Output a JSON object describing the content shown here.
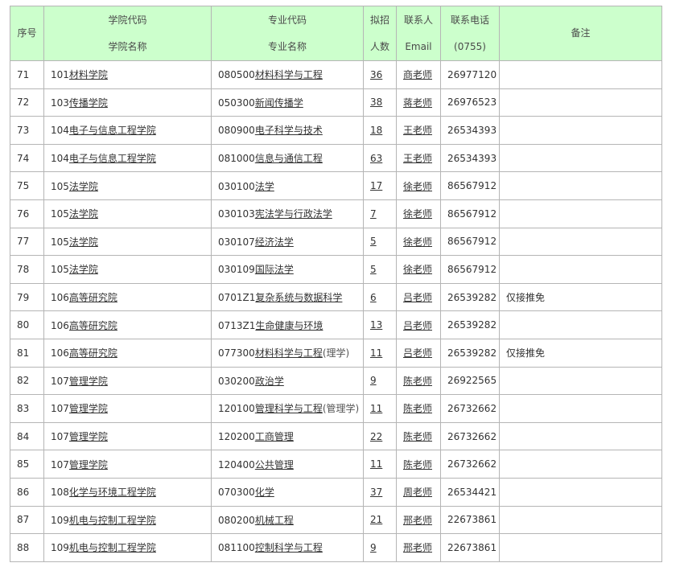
{
  "colors": {
    "header_bg": "#ccffcc",
    "border": "#b5b5b5"
  },
  "header": {
    "seq": "序号",
    "college_code": "学院代码",
    "college_name": "学院名称",
    "major_code": "专业代码",
    "major_name": "专业名称",
    "quota_1": "拟招",
    "quota_2": "人数",
    "contact_1": "联系人",
    "contact_2": "Email",
    "phone_1": "联系电话",
    "phone_2": "(0755)",
    "remark": "备注"
  },
  "rows": [
    {
      "seq": "71",
      "college_code": "101",
      "college_name": "材料学院",
      "major_code": "080500",
      "major_name": "材料科学与工程",
      "major_suffix": "",
      "quota": "36",
      "contact": "商老师",
      "phone": "26977120",
      "remark": ""
    },
    {
      "seq": "72",
      "college_code": "103",
      "college_name": "传播学院",
      "major_code": "050300",
      "major_name": "新闻传播学",
      "major_suffix": "",
      "quota": "38",
      "contact": "蒋老师",
      "phone": "26976523",
      "remark": ""
    },
    {
      "seq": "73",
      "college_code": "104",
      "college_name": "电子与信息工程学院",
      "major_code": "080900",
      "major_name": "电子科学与技术",
      "major_suffix": "",
      "quota": "18",
      "contact": "王老师",
      "phone": "26534393",
      "remark": ""
    },
    {
      "seq": "74",
      "college_code": "104",
      "college_name": "电子与信息工程学院",
      "major_code": "081000",
      "major_name": "信息与通信工程",
      "major_suffix": "",
      "quota": "63",
      "contact": "王老师",
      "phone": "26534393",
      "remark": ""
    },
    {
      "seq": "75",
      "college_code": "105",
      "college_name": "法学院",
      "major_code": "030100",
      "major_name": "法学",
      "major_suffix": "",
      "quota": "17",
      "contact": "徐老师",
      "phone": "86567912",
      "remark": ""
    },
    {
      "seq": "76",
      "college_code": "105",
      "college_name": "法学院",
      "major_code": "030103",
      "major_name": "宪法学与行政法学",
      "major_suffix": "",
      "quota": "7",
      "contact": "徐老师",
      "phone": "86567912",
      "remark": ""
    },
    {
      "seq": "77",
      "college_code": "105",
      "college_name": "法学院",
      "major_code": "030107",
      "major_name": "经济法学",
      "major_suffix": "",
      "quota": "5",
      "contact": "徐老师",
      "phone": "86567912",
      "remark": ""
    },
    {
      "seq": "78",
      "college_code": "105",
      "college_name": "法学院",
      "major_code": "030109",
      "major_name": "国际法学",
      "major_suffix": "",
      "quota": "5",
      "contact": "徐老师",
      "phone": "86567912",
      "remark": ""
    },
    {
      "seq": "79",
      "college_code": "106",
      "college_name": "高等研究院",
      "major_code": "0701Z1",
      "major_name": "复杂系统与数据科学",
      "major_suffix": "",
      "quota": "6",
      "contact": "吕老师",
      "phone": "26539282",
      "remark": "仅接推免"
    },
    {
      "seq": "80",
      "college_code": "106",
      "college_name": "高等研究院",
      "major_code": "0713Z1",
      "major_name": "生命健康与环境",
      "major_suffix": "",
      "quota": "13",
      "contact": "吕老师",
      "phone": "26539282",
      "remark": ""
    },
    {
      "seq": "81",
      "college_code": "106",
      "college_name": "高等研究院",
      "major_code": "077300",
      "major_name": "材料科学与工程",
      "major_suffix": "(理学)",
      "quota": "11",
      "contact": "吕老师",
      "phone": "26539282",
      "remark": "仅接推免"
    },
    {
      "seq": "82",
      "college_code": "107",
      "college_name": "管理学院",
      "major_code": "030200",
      "major_name": "政治学",
      "major_suffix": "",
      "quota": "9",
      "contact": "陈老师",
      "phone": "26922565",
      "remark": ""
    },
    {
      "seq": "83",
      "college_code": "107",
      "college_name": "管理学院",
      "major_code": "120100",
      "major_name": "管理科学与工程",
      "major_suffix": "(管理学)",
      "quota": "11",
      "contact": "陈老师",
      "phone": "26732662",
      "remark": ""
    },
    {
      "seq": "84",
      "college_code": "107",
      "college_name": "管理学院",
      "major_code": "120200",
      "major_name": "工商管理",
      "major_suffix": "",
      "quota": "22",
      "contact": "陈老师",
      "phone": "26732662",
      "remark": ""
    },
    {
      "seq": "85",
      "college_code": "107",
      "college_name": "管理学院",
      "major_code": "120400",
      "major_name": "公共管理",
      "major_suffix": "",
      "quota": "11",
      "contact": "陈老师",
      "phone": "26732662",
      "remark": ""
    },
    {
      "seq": "86",
      "college_code": "108",
      "college_name": "化学与环境工程学院",
      "major_code": "070300",
      "major_name": "化学",
      "major_suffix": "",
      "quota": "37",
      "contact": "周老师",
      "phone": "26534421",
      "remark": ""
    },
    {
      "seq": "87",
      "college_code": "109",
      "college_name": "机电与控制工程学院",
      "major_code": "080200",
      "major_name": "机械工程",
      "major_suffix": "",
      "quota": "21",
      "contact": "邢老师",
      "phone": "22673861",
      "remark": ""
    },
    {
      "seq": "88",
      "college_code": "109",
      "college_name": "机电与控制工程学院",
      "major_code": "081100",
      "major_name": "控制科学与工程",
      "major_suffix": "",
      "quota": "9",
      "contact": "邢老师",
      "phone": "22673861",
      "remark": ""
    }
  ]
}
